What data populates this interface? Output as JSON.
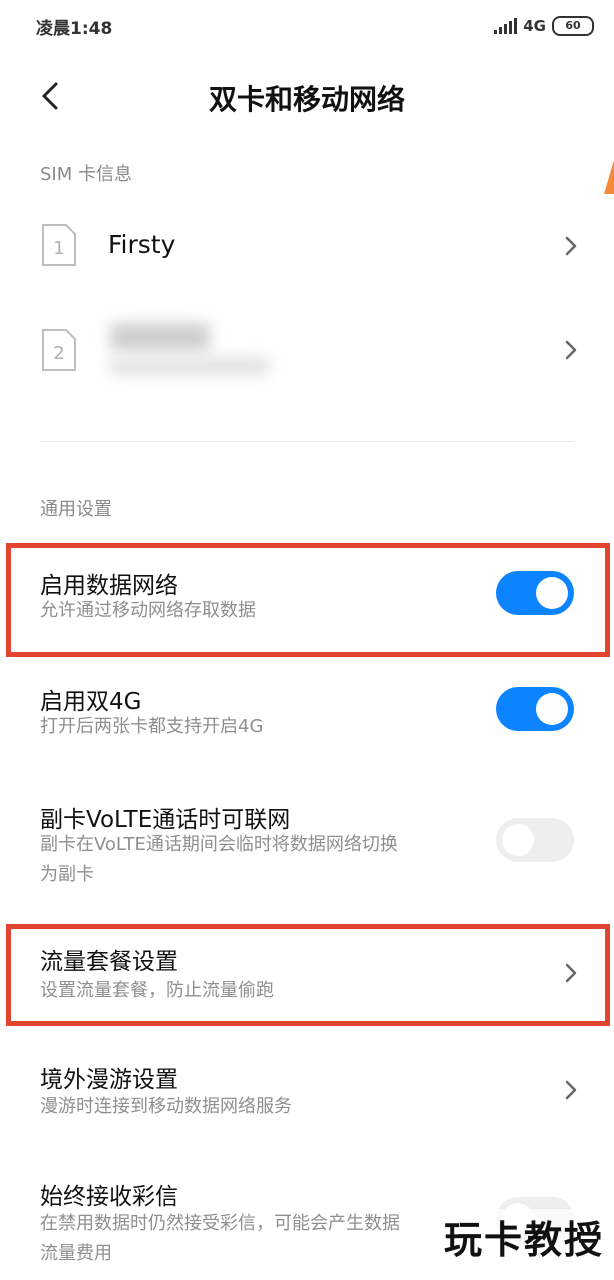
{
  "status_bar": {
    "time": "凌晨1:48",
    "network": "4G",
    "battery": "60"
  },
  "header": {
    "title": "双卡和移动网络"
  },
  "sim_section": {
    "label": "SIM 卡信息",
    "cards": [
      {
        "slot": "1",
        "name": "Firsty"
      },
      {
        "slot": "2",
        "name": ""
      }
    ]
  },
  "general_section": {
    "label": "通用设置",
    "items": [
      {
        "title": "启用数据网络",
        "subtitle": "允许通过移动网络存取数据",
        "control": "toggle",
        "state": "on"
      },
      {
        "title": "启用双4G",
        "subtitle": "打开后两张卡都支持开启4G",
        "control": "toggle",
        "state": "on"
      },
      {
        "title": "副卡VoLTE通话时可联网",
        "subtitle_lines": [
          "副卡在VoLTE通话期间会临时将数据网络切换",
          "为副卡"
        ],
        "control": "toggle",
        "state": "off"
      },
      {
        "title": "流量套餐设置",
        "subtitle": "设置流量套餐，防止流量偷跑",
        "control": "chevron"
      },
      {
        "title": "境外漫游设置",
        "subtitle": "漫游时连接到移动数据网络服务",
        "control": "chevron"
      },
      {
        "title": "始终接收彩信",
        "subtitle_lines": [
          "在禁用数据时仍然接受彩信，可能会产生数据",
          "流量费用"
        ],
        "control": "toggle",
        "state": "off"
      }
    ]
  },
  "colors": {
    "accent": "#0d84ff",
    "highlight": "#e2452f",
    "toggle_off": "#eeeeee"
  },
  "watermark": "玩卡教授"
}
